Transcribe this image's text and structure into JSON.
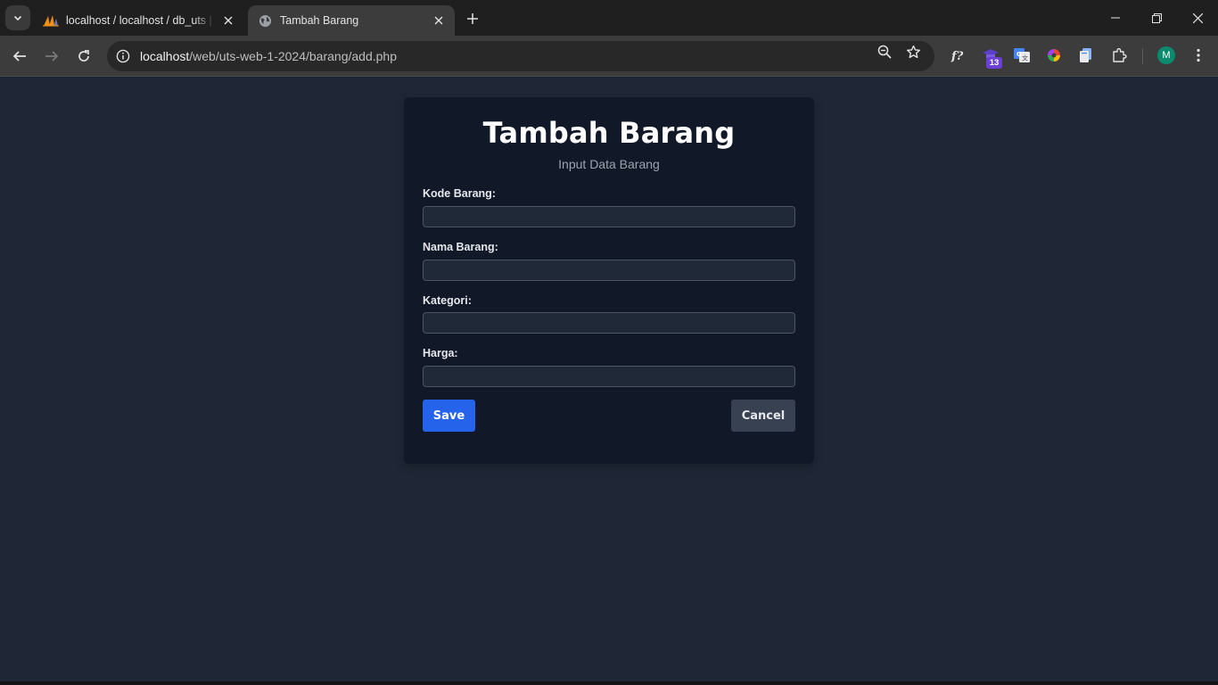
{
  "browser": {
    "tabs": [
      {
        "title": "localhost / localhost / db_uts | phpMyAdmin",
        "active": false
      },
      {
        "title": "Tambah Barang",
        "active": true
      }
    ],
    "url_host": "localhost",
    "url_path": "/web/uts-web-1-2024/barang/add.php",
    "extension_badge": "13",
    "profile_initial": "M"
  },
  "page": {
    "title": "Tambah Barang",
    "subtitle": "Input Data Barang",
    "fields": [
      {
        "label": "Kode Barang:",
        "value": ""
      },
      {
        "label": "Nama Barang:",
        "value": ""
      },
      {
        "label": "Kategori:",
        "value": ""
      },
      {
        "label": "Harga:",
        "value": ""
      }
    ],
    "save_label": "Save",
    "cancel_label": "Cancel"
  },
  "colors": {
    "page_bg": "#1f2737",
    "card_bg": "#111827",
    "save": "#2563eb",
    "cancel": "#374151"
  }
}
